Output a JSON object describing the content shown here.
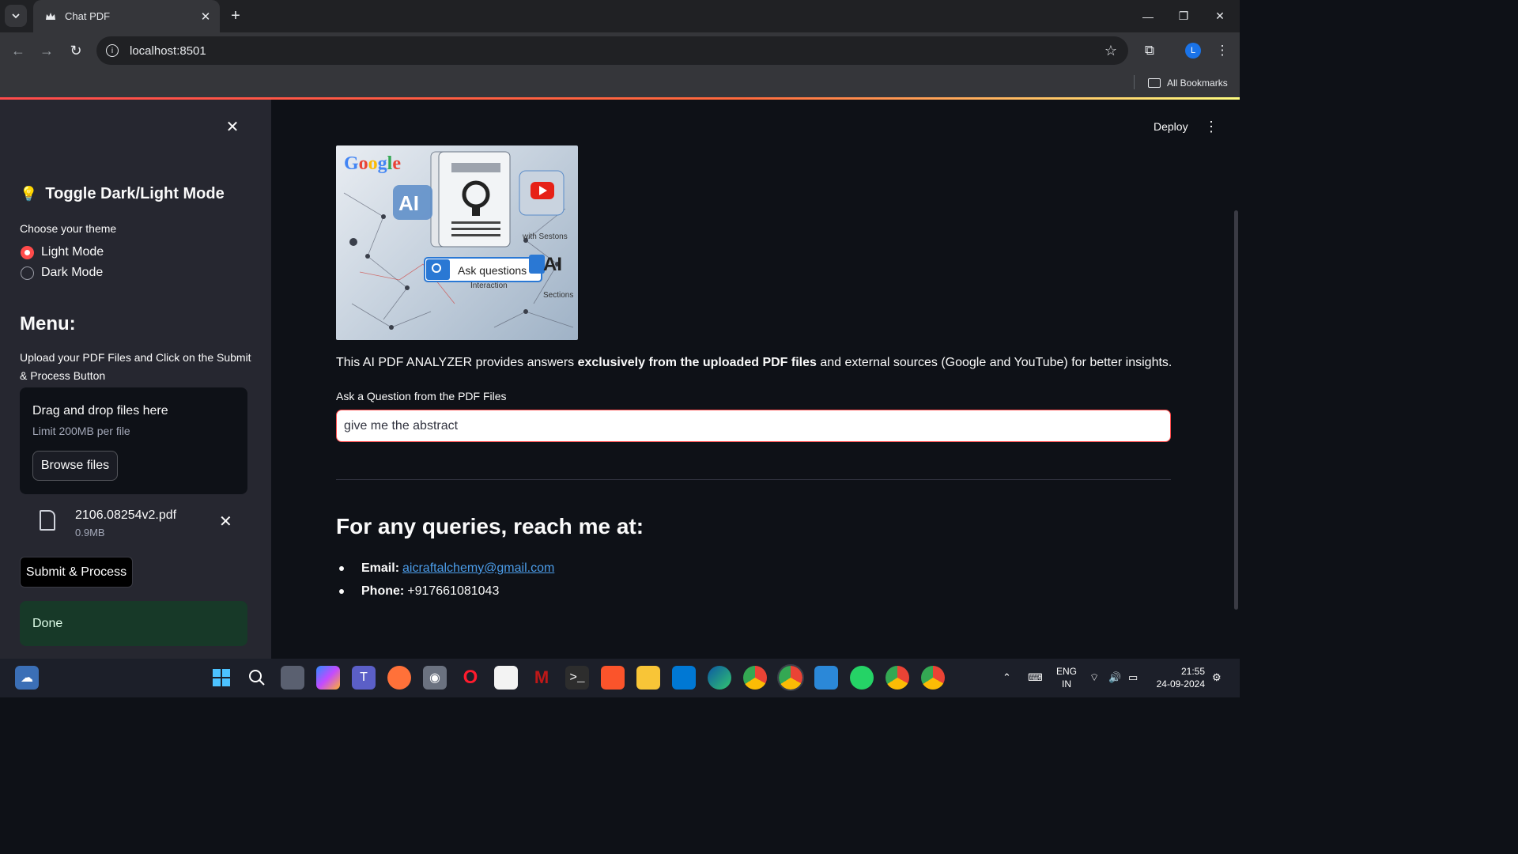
{
  "browser": {
    "tab_title": "Chat PDF",
    "url": "localhost:8501",
    "bookmarks_label": "All Bookmarks",
    "profile_initial": "L"
  },
  "sidebar": {
    "theme_heading": "Toggle Dark/Light Mode",
    "theme_prompt": "Choose your theme",
    "theme_options": [
      "Light Mode",
      "Dark Mode"
    ],
    "theme_selected": "Light Mode",
    "menu_title": "Menu:",
    "upload_description": "Upload your PDF Files and Click on the Submit & Process Button",
    "dropzone_title": "Drag and drop files here",
    "dropzone_limit": "Limit 200MB per file",
    "browse_label": "Browse files",
    "file": {
      "name": "2106.08254v2.pdf",
      "size": "0.9MB"
    },
    "submit_label": "Submit & Process",
    "status": "Done"
  },
  "main": {
    "deploy_label": "Deploy",
    "hero_image": {
      "texts": [
        "Google",
        "AI",
        "Ask questions",
        "AI",
        "Interaction",
        "Sections",
        "with Sestons"
      ]
    },
    "description_prefix": "This AI PDF ANALYZER provides answers ",
    "description_bold": "exclusively from the uploaded PDF files",
    "description_suffix": " and external sources (Google and YouTube) for better insights.",
    "question_label": "Ask a Question from the PDF Files",
    "question_value": "give me the abstract",
    "contact_heading": "For any queries, reach me at:",
    "email_label": "Email:",
    "email_value": "aicraftalchemy@gmail.com",
    "phone_label": "Phone:",
    "phone_value": "+917661081043"
  },
  "taskbar": {
    "language": [
      "ENG",
      "IN"
    ],
    "time": "21:55",
    "date": "24-09-2024"
  },
  "colors": {
    "accent": "#ff4b4b",
    "sidebar_bg": "#262730",
    "main_bg": "#0e1117",
    "success_bg": "#173928",
    "link": "#4b9ce8"
  }
}
